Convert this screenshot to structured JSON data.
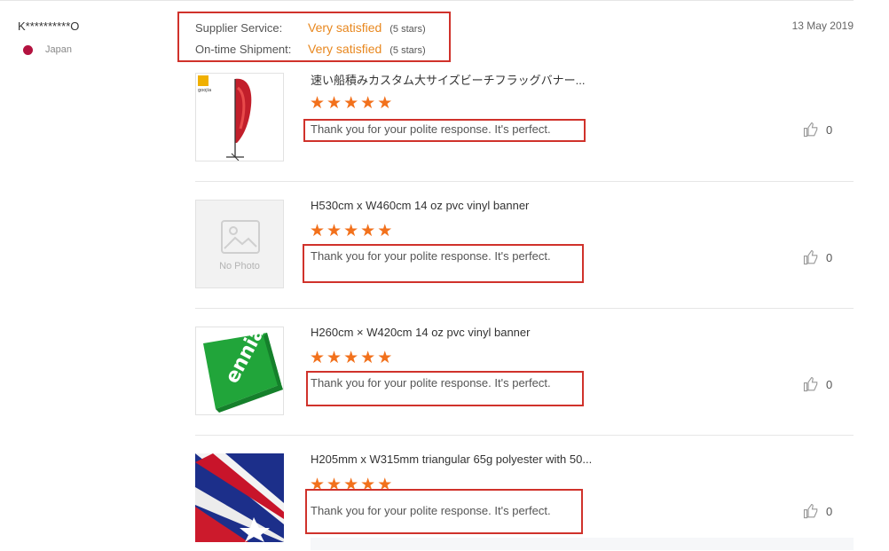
{
  "reviewer": {
    "name": "K**********O",
    "country": "Japan"
  },
  "ratings": [
    {
      "label": "Supplier Service:",
      "value": "Very satisfied",
      "stars": "(5 stars)"
    },
    {
      "label": "On-time Shipment:",
      "value": "Very satisfied",
      "stars": "(5 stars)"
    }
  ],
  "date": "13 May 2019",
  "reviews": [
    {
      "title": "速い船積みカスタム大サイズビーチフラッグバナー...",
      "rating": 5,
      "comment": "Thank you for your polite response. It's perfect.",
      "likes": "0",
      "thumb_logo": "goojia"
    },
    {
      "title": "H530cm x W460cm 14 oz pvc vinyl banner",
      "rating": 5,
      "comment": "Thank you for your polite response. It's perfect.",
      "likes": "0",
      "no_photo": "No Photo"
    },
    {
      "title": "H260cm × W420cm 14 oz pvc vinyl banner",
      "rating": 5,
      "comment": "Thank you for your polite response. It's perfect.",
      "likes": "0",
      "thumb_logo": "ennia"
    },
    {
      "title": "H205mm x W315mm triangular 65g polyester with 50...",
      "rating": 5,
      "comment": "Thank you for your polite response. It's perfect.",
      "likes": "0"
    }
  ],
  "colors": {
    "accent": "#e8871e",
    "star": "#f2711c",
    "highlight_box": "#d0322b",
    "flag_dot": "#b3123f"
  }
}
